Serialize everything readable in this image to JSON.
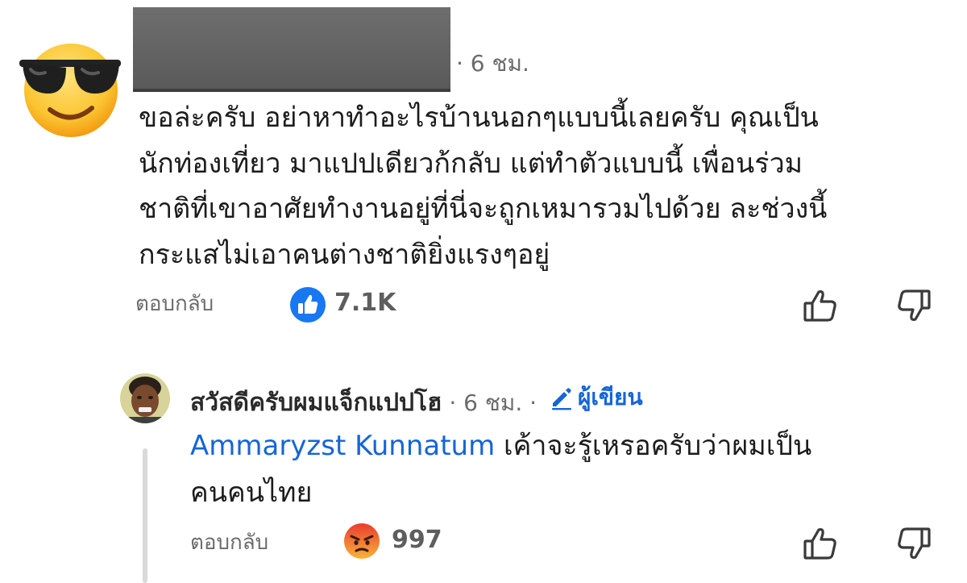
{
  "comment": {
    "avatar_icon": "sunglasses-emoji-icon",
    "author_redacted": true,
    "time": "· 6 ชม.",
    "text_lines": [
      "ขอล่ะครับ อย่าหาทำอะไรบ้านนอกๆแบบนี้เลยครับ คุณเป็น",
      "นักท่องเที่ยว มาแปปเดียวก้กลับ แต่ทำตัวแบบนี้ เพื่อนร่วม",
      "ชาติที่เขาอาศัยทำงานอยู่ที่นี่จะถูกเหมารวมไปด้วย ละช่วงนี้",
      "กระแสไม่เอาคนต่างชาติยิ่งแรงๆอยู่"
    ],
    "reply_label": "ตอบกลับ",
    "reaction_icon": "thumbs-up-reaction-icon",
    "reaction_count": "7.1K",
    "colors": {
      "reaction": "#1877f2"
    }
  },
  "reply": {
    "author": "สวัสดีครับผมแจ็กแปปโฮ",
    "time": " · 6 ชม. · ",
    "author_badge": "ผู้เขียน",
    "mention": "Ammaryzst Kunnatum",
    "text_line1": " เค้าจะรู้เหรอครับว่าผมเป็น",
    "text_line2": "คนคนไทย",
    "reply_label": "ตอบกลับ",
    "reaction_icon": "angry-face-reaction-icon",
    "reaction_count": "997",
    "colors": {
      "mention": "#1565d8",
      "badge": "#1565d8",
      "reaction": "#f05a2a"
    }
  }
}
